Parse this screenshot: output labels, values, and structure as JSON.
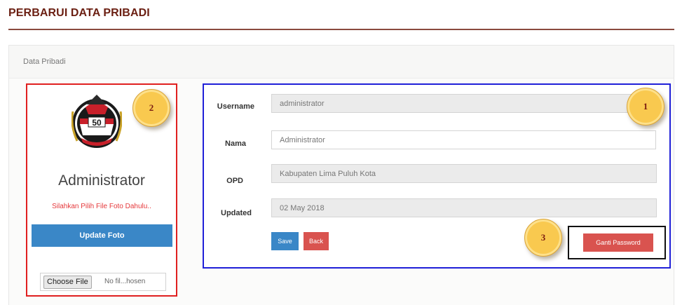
{
  "page": {
    "title": "PERBARUI DATA PRIBADI"
  },
  "panel": {
    "heading": "Data Pribadi"
  },
  "profile": {
    "logo_text": "50",
    "name": "Administrator",
    "photo_hint": "Silahkan Pilih File Foto Dahulu..",
    "update_photo_label": "Update Foto",
    "choose_file_label": "Choose File",
    "file_status": "No fil...hosen"
  },
  "form": {
    "fields": [
      {
        "label": "Username",
        "value": "administrator"
      },
      {
        "label": "Nama",
        "value": "Administrator"
      },
      {
        "label": "OPD",
        "value": "Kabupaten Lima Puluh Kota"
      },
      {
        "label": "Updated",
        "value": "02 May 2018"
      }
    ],
    "save_label": "Save",
    "back_label": "Back",
    "change_password_label": "Ganti Password"
  },
  "markers": [
    "1",
    "2",
    "3"
  ],
  "colors": {
    "title": "#6b1f12",
    "primary": "#3a87c7",
    "danger": "#d9534f",
    "left_box_border": "#e02020",
    "right_box_border": "#2020d8",
    "marker_fill": "#f9c94f"
  }
}
